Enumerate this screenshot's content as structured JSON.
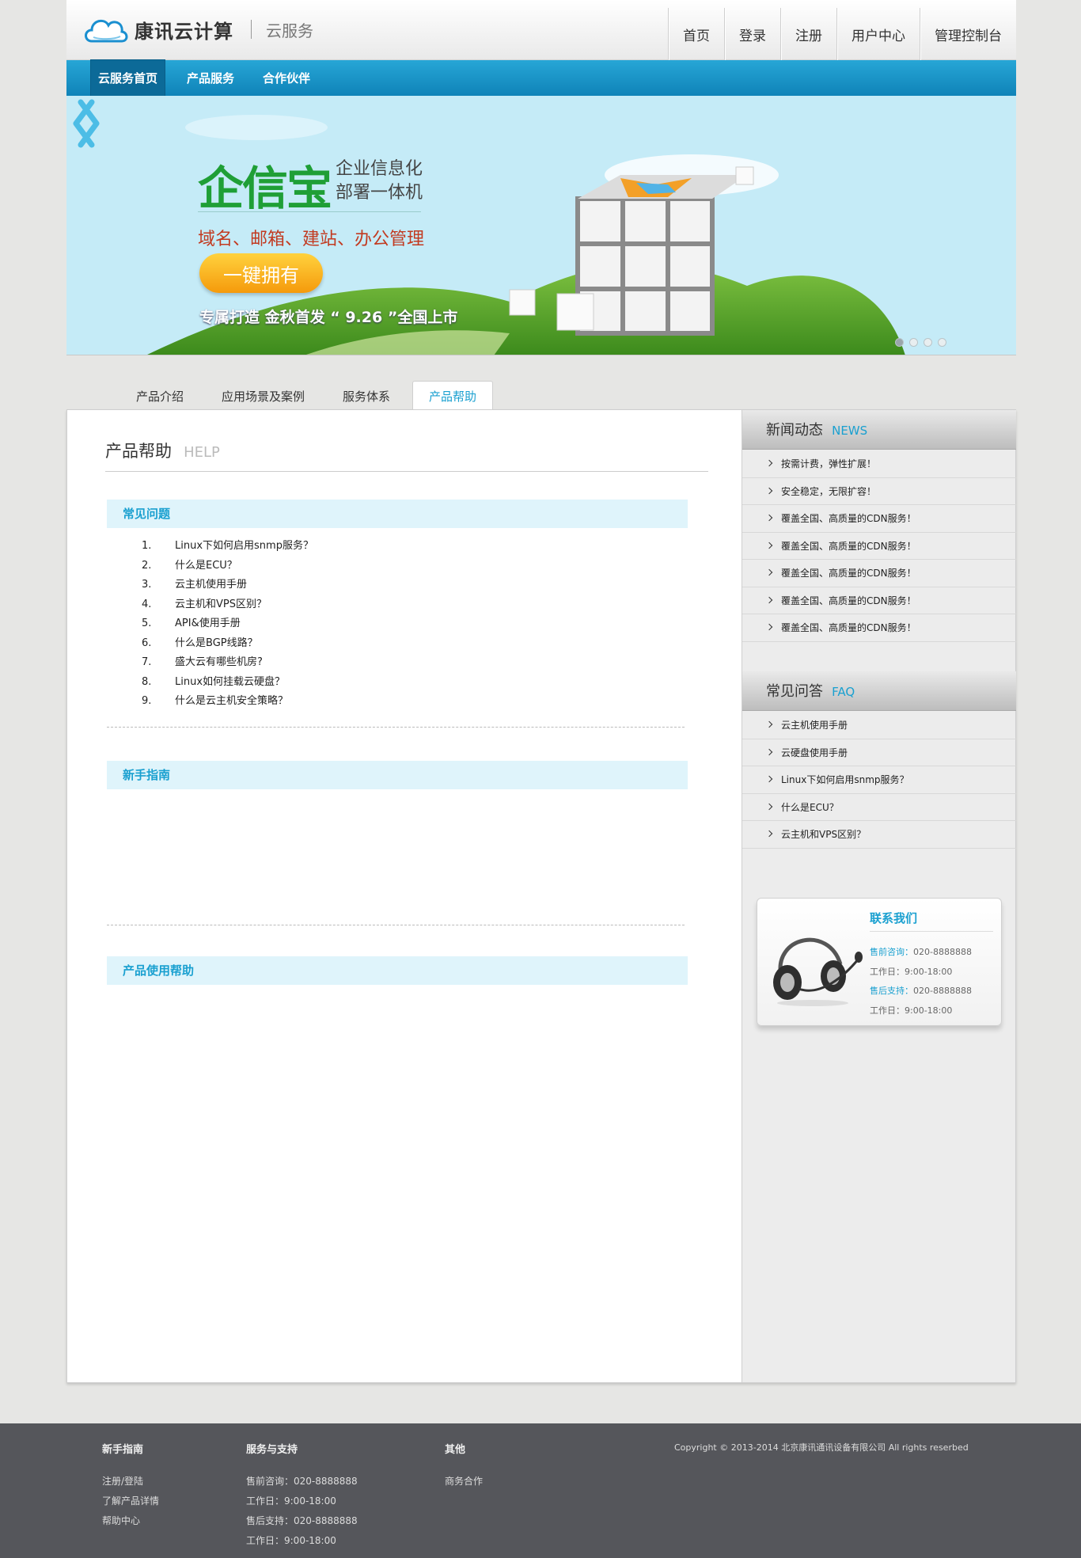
{
  "header": {
    "logo_text": "康讯云计算",
    "logo_sub": "云服务",
    "topnav": [
      "首页",
      "登录",
      "注册",
      "用户中心",
      "管理控制台"
    ]
  },
  "subnav": [
    "云服务首页",
    "产品服务",
    "合作伙伴"
  ],
  "banner": {
    "title_big": "企信宝",
    "title_side_1": "企业信息化",
    "title_side_2": "部署一体机",
    "services": "域名、邮箱、建站、办公管理",
    "button": "一键拥有",
    "slogan": "专属打造  金秋首发  “ 9.26 ”全国上市",
    "slide_count": 4,
    "active_slide": 1
  },
  "tabs": [
    "产品介绍",
    "应用场景及案例",
    "服务体系",
    "产品帮助"
  ],
  "content": {
    "title_cn": "产品帮助",
    "title_en": "HELP",
    "sections": {
      "faq": "常见问题",
      "guide": "新手指南",
      "usage": "产品使用帮助"
    },
    "faq_items": [
      {
        "num": "1.",
        "text": "Linux下如何启用snmp服务？"
      },
      {
        "num": "2.",
        "text": "什么是ECU？"
      },
      {
        "num": "3.",
        "text": "云主机使用手册"
      },
      {
        "num": "4.",
        "text": "云主机和VPS区别？"
      },
      {
        "num": "5.",
        "text": "API&使用手册"
      },
      {
        "num": "6.",
        "text": "什么是BGP线路？"
      },
      {
        "num": "7.",
        "text": "盛大云有哪些机房?"
      },
      {
        "num": "8.",
        "text": "Linux如何挂载云硬盘？"
      },
      {
        "num": "9.",
        "text": "什么是云主机安全策略？"
      }
    ]
  },
  "sidebar": {
    "news_cn": "新闻动态",
    "news_en": "NEWS",
    "news": [
      "按需计费，弹性扩展！",
      "安全稳定，无限扩容！",
      "覆盖全国、高质量的CDN服务！",
      "覆盖全国、高质量的CDN服务！",
      "覆盖全国、高质量的CDN服务！",
      "覆盖全国、高质量的CDN服务！",
      "覆盖全国、高质量的CDN服务！"
    ],
    "faq_cn": "常见问答",
    "faq_en": "FAQ",
    "faq": [
      "云主机使用手册",
      "云硬盘使用手册",
      "Linux下如何启用snmp服务？",
      "什么是ECU？",
      "云主机和VPS区别？"
    ],
    "contact": {
      "title": "联系我们",
      "presale_key": "售前咨询：",
      "presale_val": "020-8888888",
      "hours_1": "工作日：9:00-18:00",
      "support_key": "售后支持：",
      "support_val": "020-8888888",
      "hours_2": "工作日：9:00-18:00"
    }
  },
  "footer": {
    "col1_title": "新手指南",
    "col1": [
      "注册/登陆",
      "了解产品详情",
      "帮助中心"
    ],
    "col2_title": "服务与支持",
    "col2": [
      "售前咨询：020-8888888",
      "工作日：9:00-18:00",
      "售后支持：020-8888888",
      "工作日：9:00-18:00"
    ],
    "col3_title": "其他",
    "col3": [
      "商务合作"
    ],
    "copyright": "Copyright © 2013-2014  北京康讯通讯设备有限公司   All rights reserbed"
  },
  "colors": {
    "accent": "#1aa0d0",
    "subnav": "#1593c6",
    "footer": "#55565b",
    "banner_green": "#1f9f36"
  }
}
